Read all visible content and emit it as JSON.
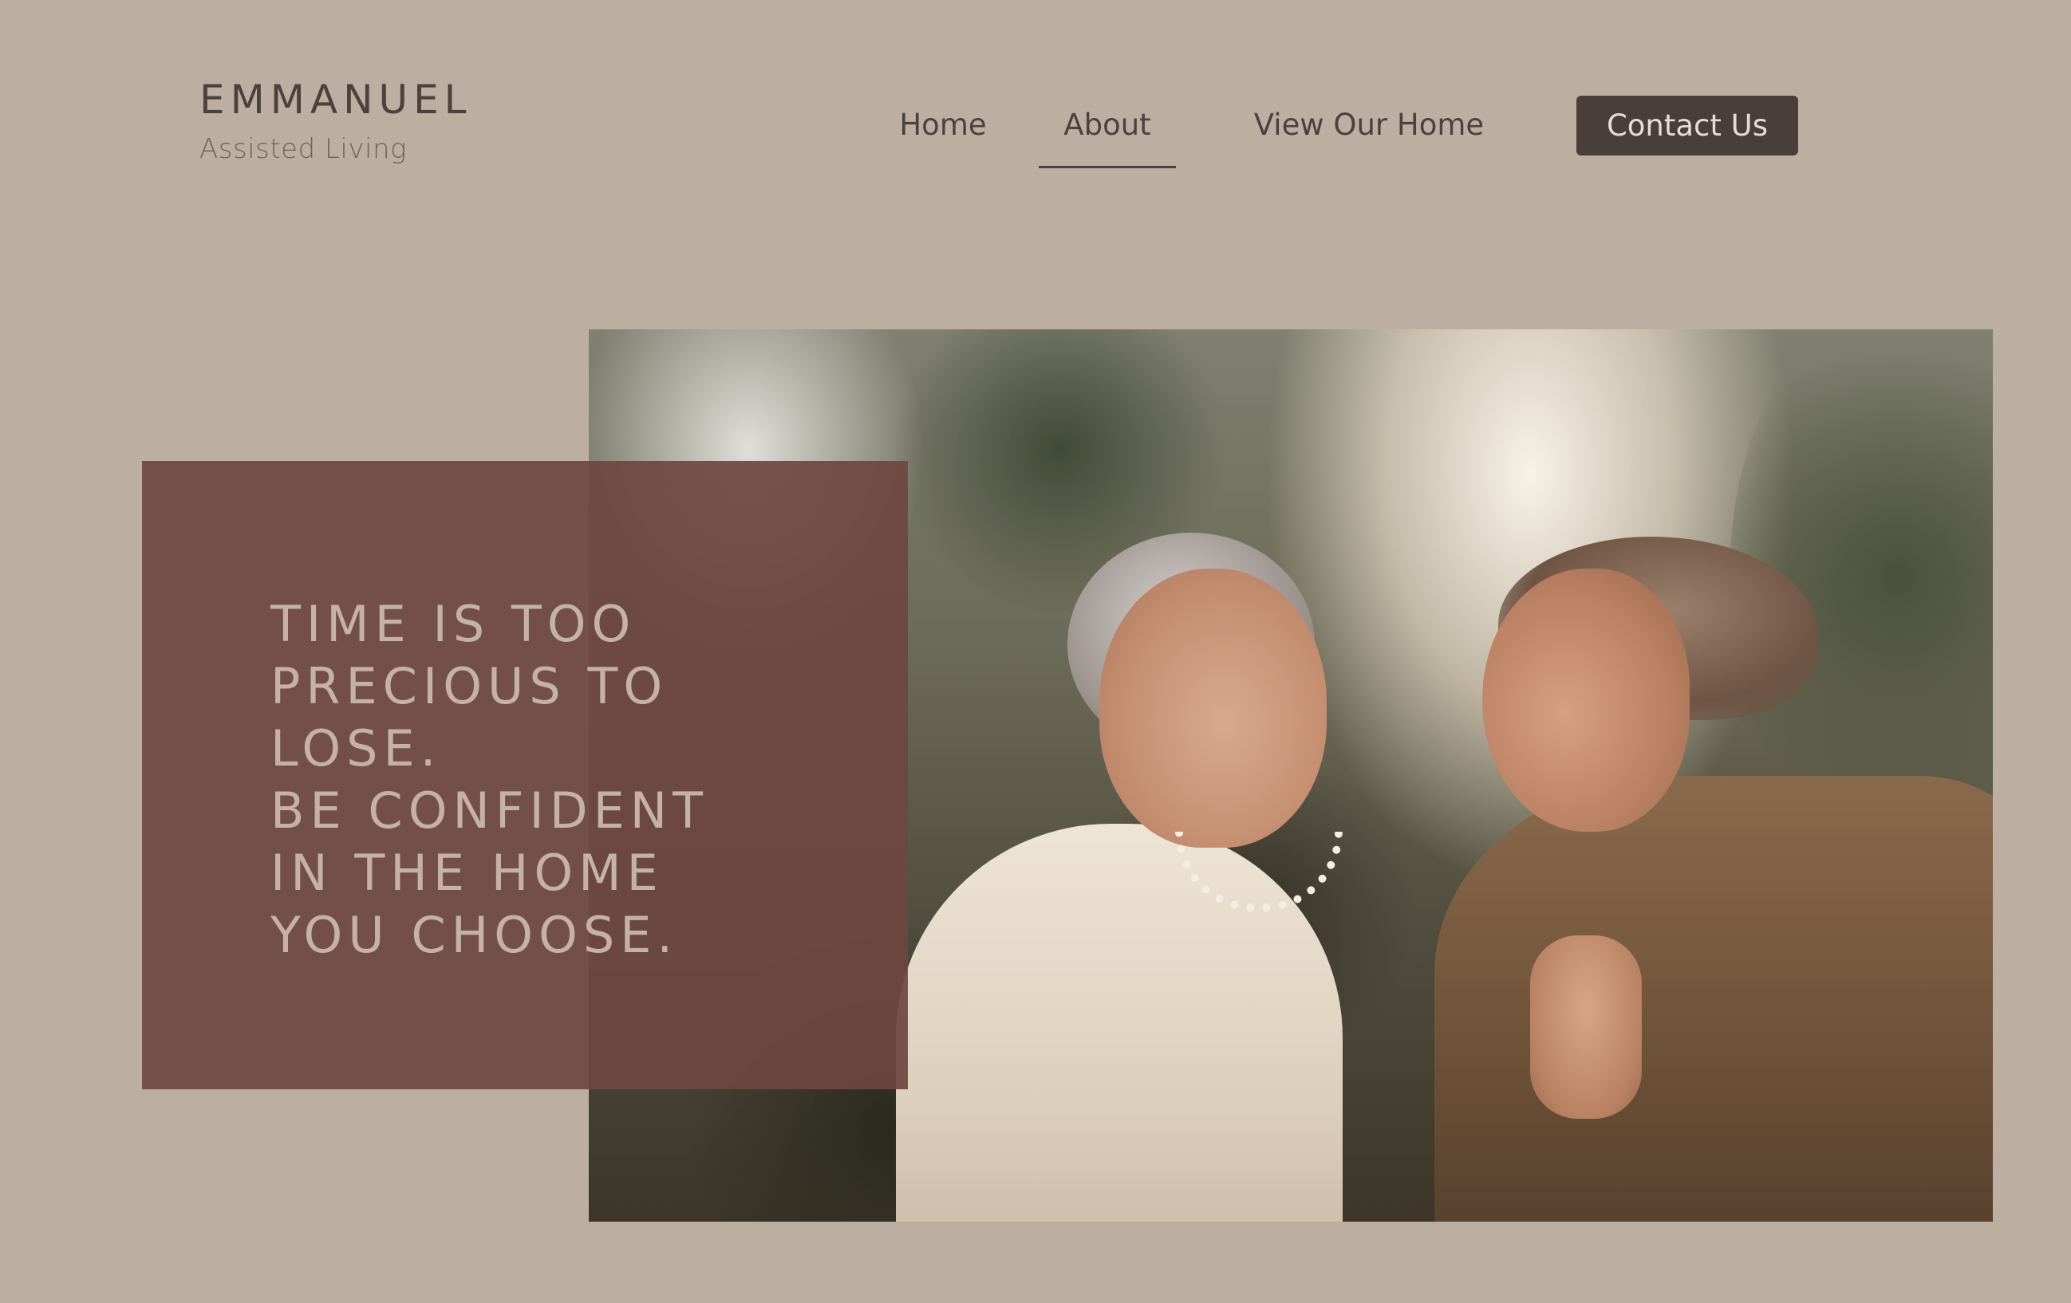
{
  "brand": {
    "name": "EMMANUEL",
    "tagline": "Assisted Living"
  },
  "nav": {
    "items": [
      {
        "label": "Home"
      },
      {
        "label": "About",
        "active": true
      },
      {
        "label": "View Our Home"
      }
    ],
    "cta_label": "Contact Us"
  },
  "hero": {
    "quote_lines": [
      "TIME IS TOO",
      "PRECIOUS TO",
      "LOSE.",
      "BE CONFIDENT",
      "IN THE HOME",
      "YOU CHOOSE."
    ]
  },
  "colors": {
    "background": "#bcafa2",
    "text_dark": "#4c413d",
    "button_bg": "#4a3e3b",
    "overlay": "#6e4640",
    "quote_text": "#c4b2a4"
  }
}
